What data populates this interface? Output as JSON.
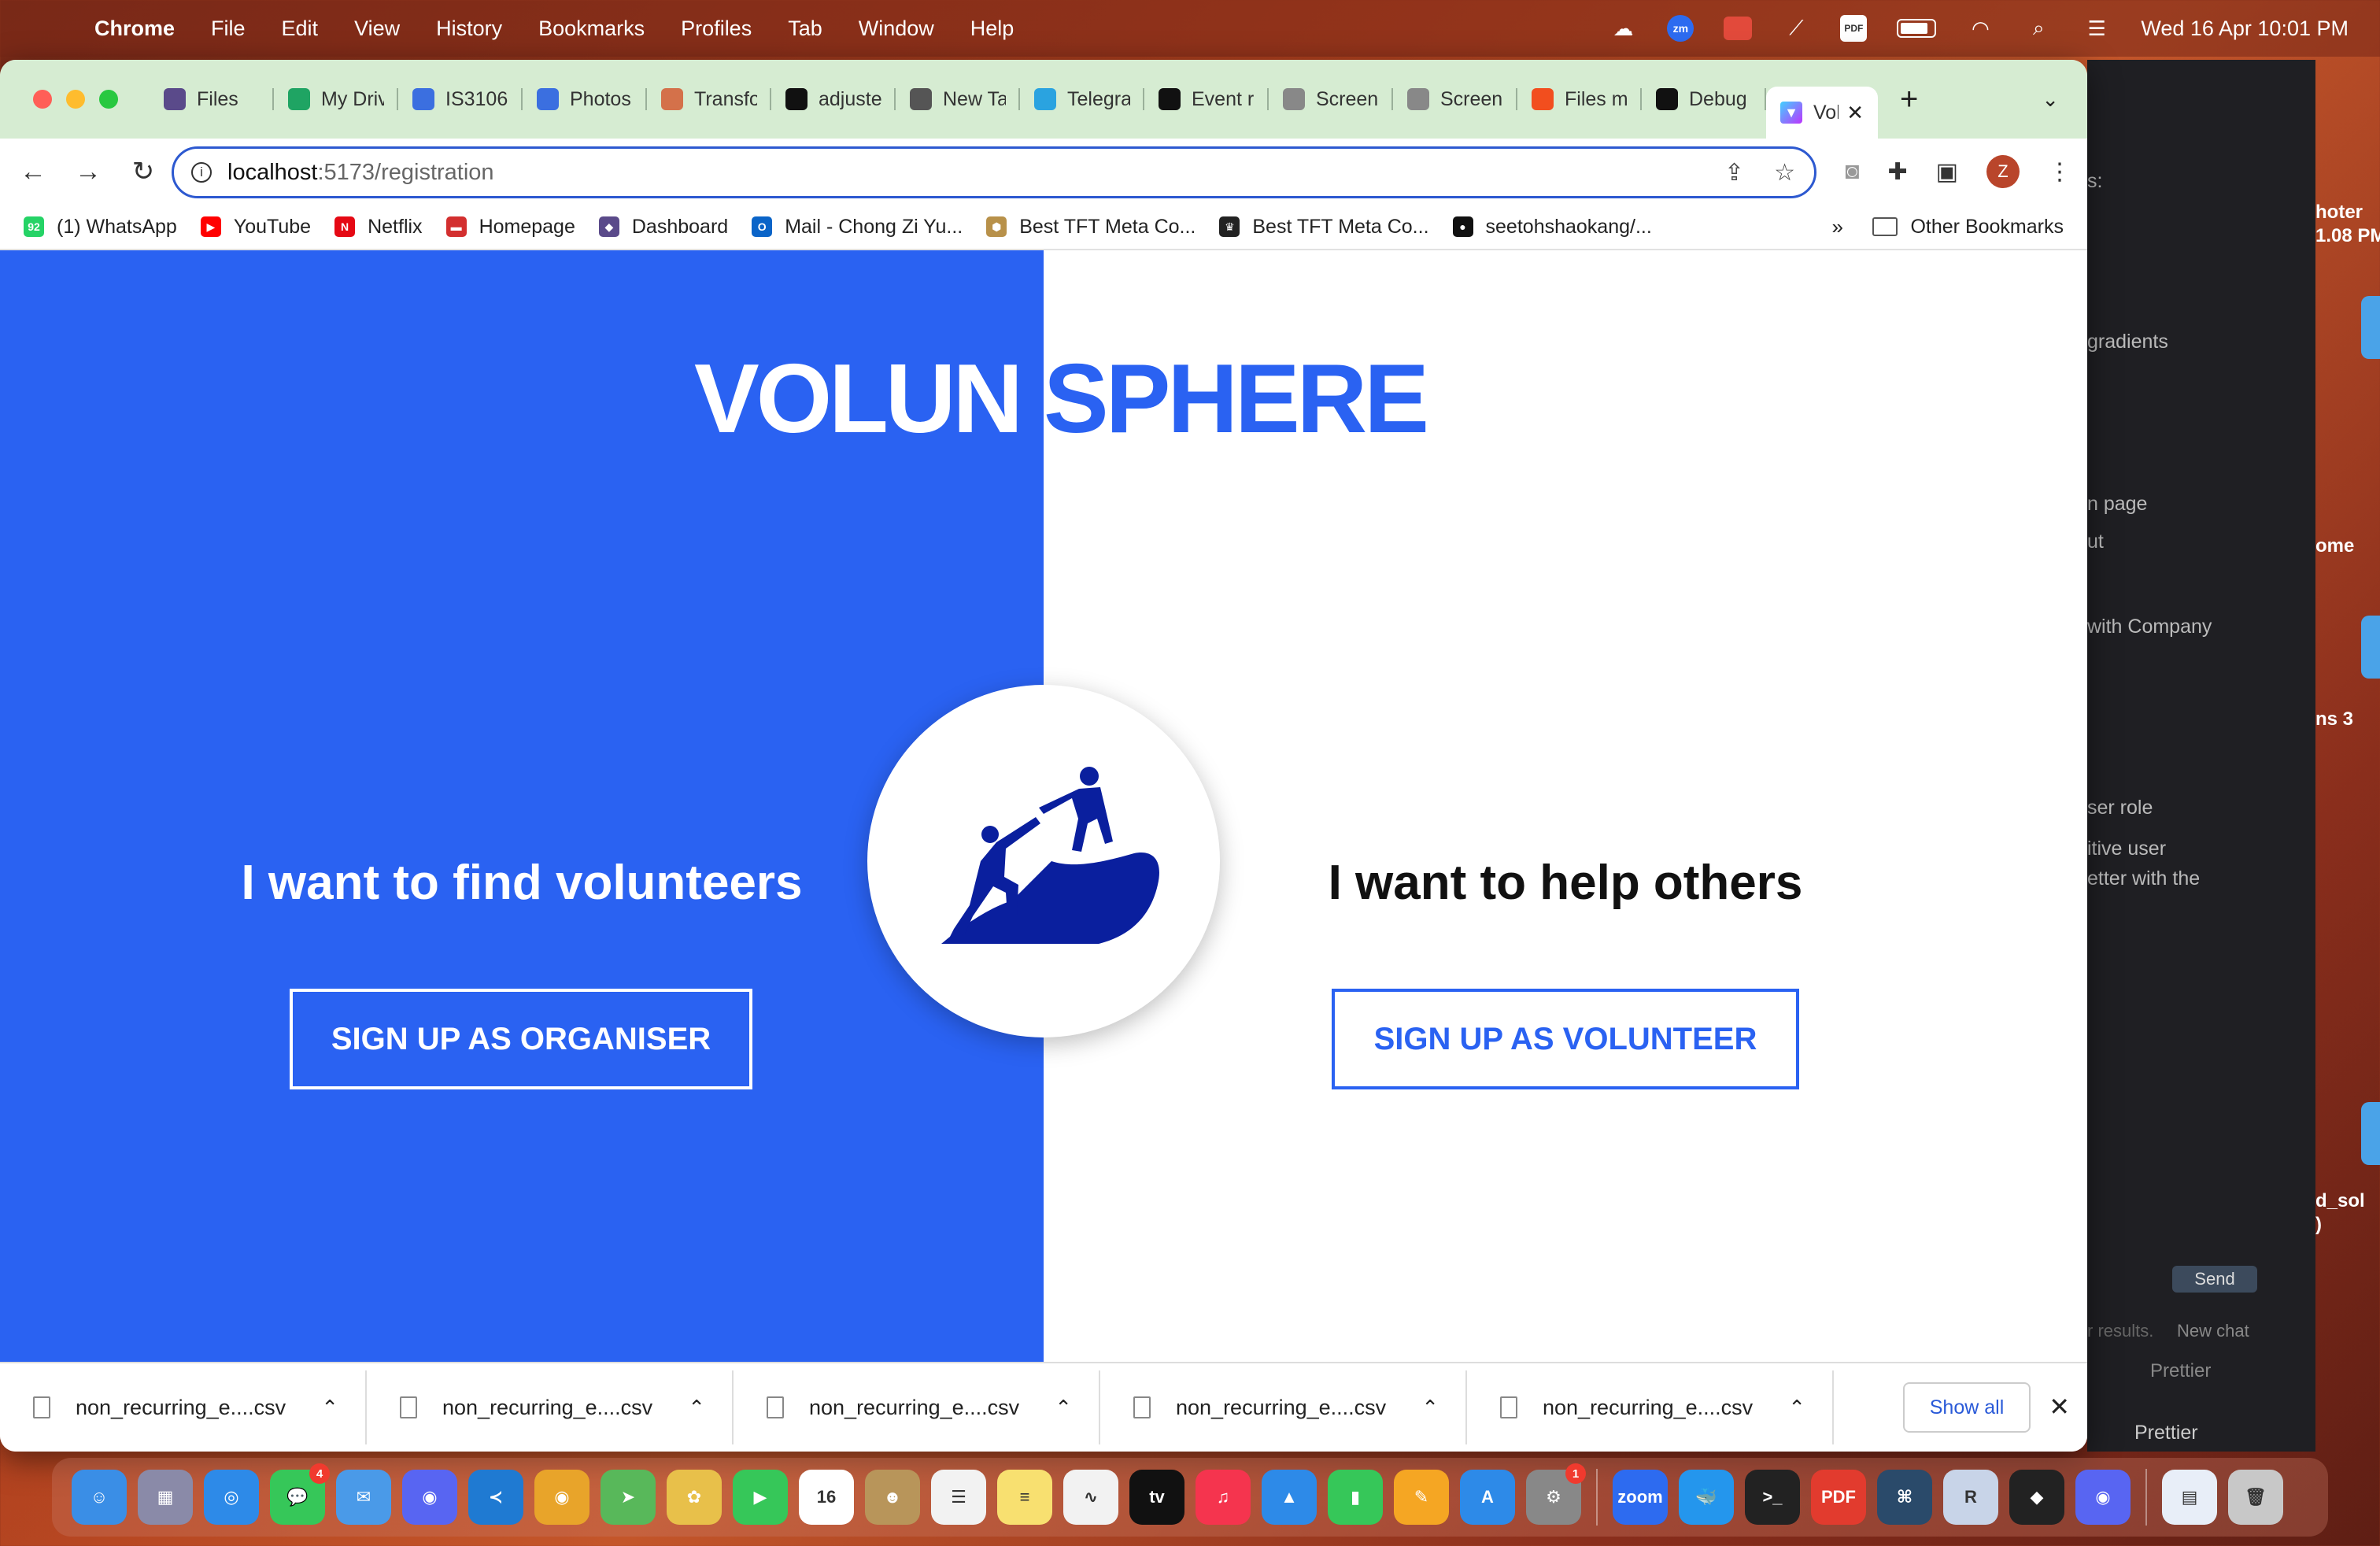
{
  "menubar": {
    "app_name": "Chrome",
    "menus": [
      "File",
      "Edit",
      "View",
      "History",
      "Bookmarks",
      "Profiles",
      "Tab",
      "Window",
      "Help"
    ],
    "datetime": "Wed 16 Apr  10:01 PM",
    "status_icons": [
      "weather-icon",
      "zoom-icon",
      "red-app-icon",
      "feather-icon",
      "pdf-icon",
      "battery-icon",
      "wifi-icon",
      "search-icon",
      "control-center-icon"
    ]
  },
  "browser": {
    "tabs": [
      {
        "label": "Files",
        "icon": "nus-crest-icon",
        "color": "#5a4a8a"
      },
      {
        "label": "My Drive",
        "icon": "google-drive-icon",
        "color": "#1fa463"
      },
      {
        "label": "IS3106",
        "icon": "google-docs-icon",
        "color": "#3b6fe0"
      },
      {
        "label": "Photos",
        "icon": "google-docs-icon",
        "color": "#3b6fe0"
      },
      {
        "label": "Transform",
        "icon": "claude-icon",
        "color": "#d4714a"
      },
      {
        "label": "adjusted",
        "icon": "github-icon",
        "color": "#111111"
      },
      {
        "label": "New Tab",
        "icon": "chrome-icon",
        "color": "#555555"
      },
      {
        "label": "Telegram",
        "icon": "telegram-icon",
        "color": "#2aa3e0"
      },
      {
        "label": "Event r",
        "icon": "openai-icon",
        "color": "#111111"
      },
      {
        "label": "Screen",
        "icon": "camera-icon",
        "color": "#888888"
      },
      {
        "label": "Screen",
        "icon": "camera-icon",
        "color": "#888888"
      },
      {
        "label": "Files m",
        "icon": "figma-icon",
        "color": "#f24e1e"
      },
      {
        "label": "Debug",
        "icon": "github-icon",
        "color": "#111111"
      }
    ],
    "active_tab": {
      "label": "Vol",
      "icon": "vite-icon"
    },
    "url_host": "localhost",
    "url_path": ":5173/registration",
    "bookmarks": [
      {
        "label": "(1) WhatsApp",
        "color": "#25d366",
        "glyph": "92"
      },
      {
        "label": "YouTube",
        "color": "#ff0000",
        "glyph": "▶"
      },
      {
        "label": "Netflix",
        "color": "#e50914",
        "glyph": "N"
      },
      {
        "label": "Homepage",
        "color": "#d32f2f",
        "glyph": "▬"
      },
      {
        "label": "Dashboard",
        "color": "#5a4a8a",
        "glyph": "◆"
      },
      {
        "label": "Mail - Chong Zi Yu...",
        "color": "#0a64c8",
        "glyph": "O"
      },
      {
        "label": "Best TFT Meta Co...",
        "color": "#b8914a",
        "glyph": "⬢"
      },
      {
        "label": "Best TFT Meta Co...",
        "color": "#222222",
        "glyph": "♛"
      },
      {
        "label": "seetohshaokang/...",
        "color": "#111111",
        "glyph": "●"
      }
    ],
    "bookmarks_more": "»",
    "other_bookmarks": "Other Bookmarks"
  },
  "page": {
    "logo_left": "VOLUN",
    "logo_right": "SPHERE",
    "left_tagline": "I want to find volunteers",
    "right_tagline": "I want to help others",
    "organiser_button": "SIGN UP AS ORGANISER",
    "volunteer_button": "SIGN UP AS VOLUNTEER",
    "emblem_icon": "climbers-helping-icon",
    "colors": {
      "primary": "#2a62f2",
      "emblem": "#0a1f9e"
    }
  },
  "downloads": {
    "items": [
      "non_recurring_e....csv",
      "non_recurring_e....csv",
      "non_recurring_e....csv",
      "non_recurring_e....csv",
      "non_recurring_e....csv"
    ],
    "show_all": "Show all"
  },
  "background_app": {
    "lines": [
      "s:",
      "gradients",
      "n page",
      "ut",
      "with Company",
      "ser role",
      "itive user",
      "etter with the"
    ],
    "send": "Send",
    "footer_left": "r results.",
    "footer_new_chat": "New chat",
    "prettier": "Prettier",
    "prettier2": "Prettier"
  },
  "desktop": {
    "labels": [
      "hoter",
      "1.08 PM",
      "ome",
      "ns 3",
      "d_sol",
      ")"
    ]
  },
  "dock": {
    "apps": [
      {
        "name": "finder-icon",
        "color": "#3a8ee6",
        "glyph": "☺"
      },
      {
        "name": "launchpad-icon",
        "color": "#8a8aa8",
        "glyph": "▦"
      },
      {
        "name": "safari-icon",
        "color": "#2d8ae8",
        "glyph": "◎"
      },
      {
        "name": "messages-icon",
        "color": "#36c759",
        "glyph": "💬",
        "badge": "4"
      },
      {
        "name": "mail-icon",
        "color": "#4a9ae8",
        "glyph": "✉"
      },
      {
        "name": "discord-icon",
        "color": "#5865f2",
        "glyph": "◉"
      },
      {
        "name": "vscode-icon",
        "color": "#1f7ad2",
        "glyph": "≺"
      },
      {
        "name": "chrome-icon",
        "color": "#e8a42a",
        "glyph": "◉"
      },
      {
        "name": "maps-icon",
        "color": "#58b85a",
        "glyph": "➤"
      },
      {
        "name": "photos-icon",
        "color": "#e8c04a",
        "glyph": "✿"
      },
      {
        "name": "facetime-icon",
        "color": "#36c759",
        "glyph": "▶"
      },
      {
        "name": "calendar-icon",
        "color": "#ffffff",
        "glyph": "16"
      },
      {
        "name": "contacts-icon",
        "color": "#b8955a",
        "glyph": "☻"
      },
      {
        "name": "reminders-icon",
        "color": "#f2f2f2",
        "glyph": "☰"
      },
      {
        "name": "notes-icon",
        "color": "#f8e070",
        "glyph": "≡"
      },
      {
        "name": "freeform-icon",
        "color": "#f2f2f2",
        "glyph": "∿"
      },
      {
        "name": "appletv-icon",
        "color": "#111111",
        "glyph": "tv"
      },
      {
        "name": "music-icon",
        "color": "#f5344e",
        "glyph": "♫"
      },
      {
        "name": "keynote-icon",
        "color": "#2d8ae8",
        "glyph": "▲"
      },
      {
        "name": "numbers-icon",
        "color": "#36c759",
        "glyph": "▮"
      },
      {
        "name": "pages-icon",
        "color": "#f5a623",
        "glyph": "✎"
      },
      {
        "name": "appstore-icon",
        "color": "#2d8ae8",
        "glyph": "A"
      },
      {
        "name": "settings-icon",
        "color": "#888888",
        "glyph": "⚙",
        "badge": "1"
      },
      {
        "name": "zoom-icon",
        "color": "#2d6bf0",
        "glyph": "zoom"
      },
      {
        "name": "docker-icon",
        "color": "#2496ed",
        "glyph": "🐳"
      },
      {
        "name": "terminal-icon",
        "color": "#222222",
        "glyph": ">_"
      },
      {
        "name": "pdf-expert-icon",
        "color": "#e23b2e",
        "glyph": "PDF"
      },
      {
        "name": "mysql-workbench-icon",
        "color": "#2a4a6a",
        "glyph": "⌘"
      },
      {
        "name": "r-icon",
        "color": "#c8d4e8",
        "glyph": "R"
      },
      {
        "name": "unity-icon",
        "color": "#222222",
        "glyph": "◆"
      },
      {
        "name": "discord-icon-2",
        "color": "#5865f2",
        "glyph": "◉"
      },
      {
        "name": "preview-icon",
        "color": "#e8eef8",
        "glyph": "▤"
      },
      {
        "name": "trash-icon",
        "color": "#c8c8c8",
        "glyph": "🗑"
      }
    ]
  }
}
